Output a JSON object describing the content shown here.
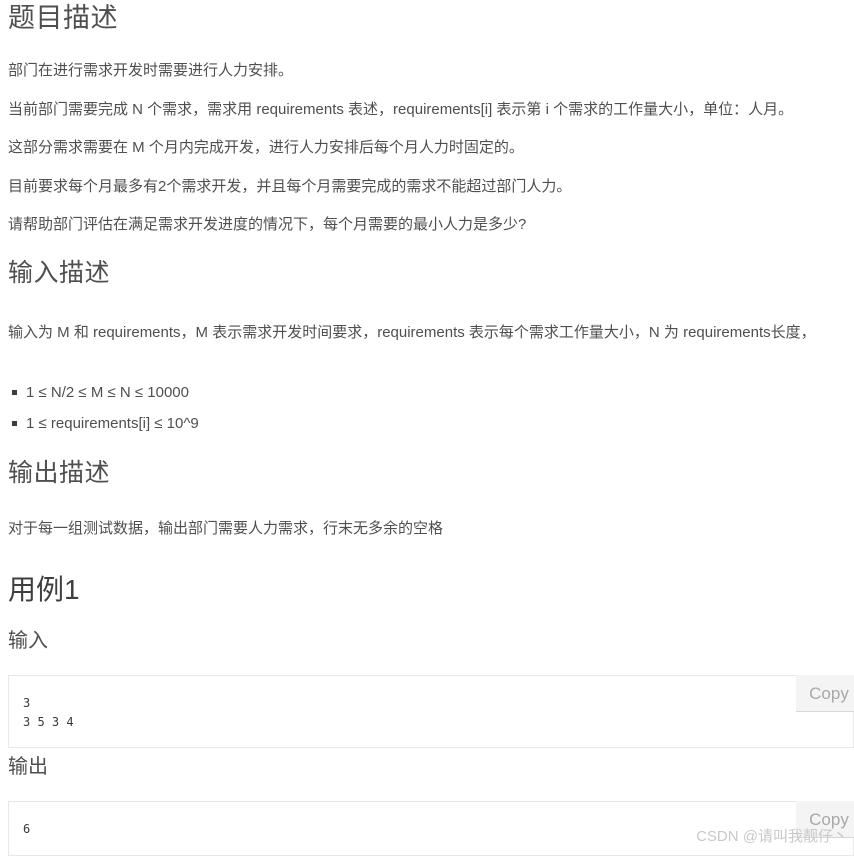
{
  "document": {
    "sections": {
      "problem": {
        "heading": "题目描述",
        "paragraphs": [
          "部门在进行需求开发时需要进行人力安排。",
          "当前部门需要完成 N 个需求，需求用 requirements 表述，requirements[i] 表示第 i 个需求的工作量大小，单位：人月。",
          "这部分需求需要在 M 个月内完成开发，进行人力安排后每个月人力时固定的。",
          "目前要求每个月最多有2个需求开发，并且每个月需要完成的需求不能超过部门人力。",
          "请帮助部门评估在满足需求开发进度的情况下，每个月需要的最小人力是多少?"
        ]
      },
      "input_desc": {
        "heading": "输入描述",
        "paragraph": "输入为 M 和 requirements，M 表示需求开发时间要求，requirements 表示每个需求工作量大小，N 为 requirements长度，",
        "constraints": [
          "1 ≤ N/2 ≤ M ≤ N ≤ 10000",
          "1 ≤ requirements[i] ≤ 10^9"
        ]
      },
      "output_desc": {
        "heading": "输出描述",
        "paragraph": "对于每一组测试数据，输出部门需要人力需求，行末无多余的空格"
      },
      "example": {
        "heading": "用例1",
        "input_label": "输入",
        "input_code": "3\n3 5 3 4",
        "output_label": "输出",
        "output_code": "6",
        "copy_label": "Copy"
      }
    },
    "watermark": "CSDN @请叫我靓仔丶"
  }
}
